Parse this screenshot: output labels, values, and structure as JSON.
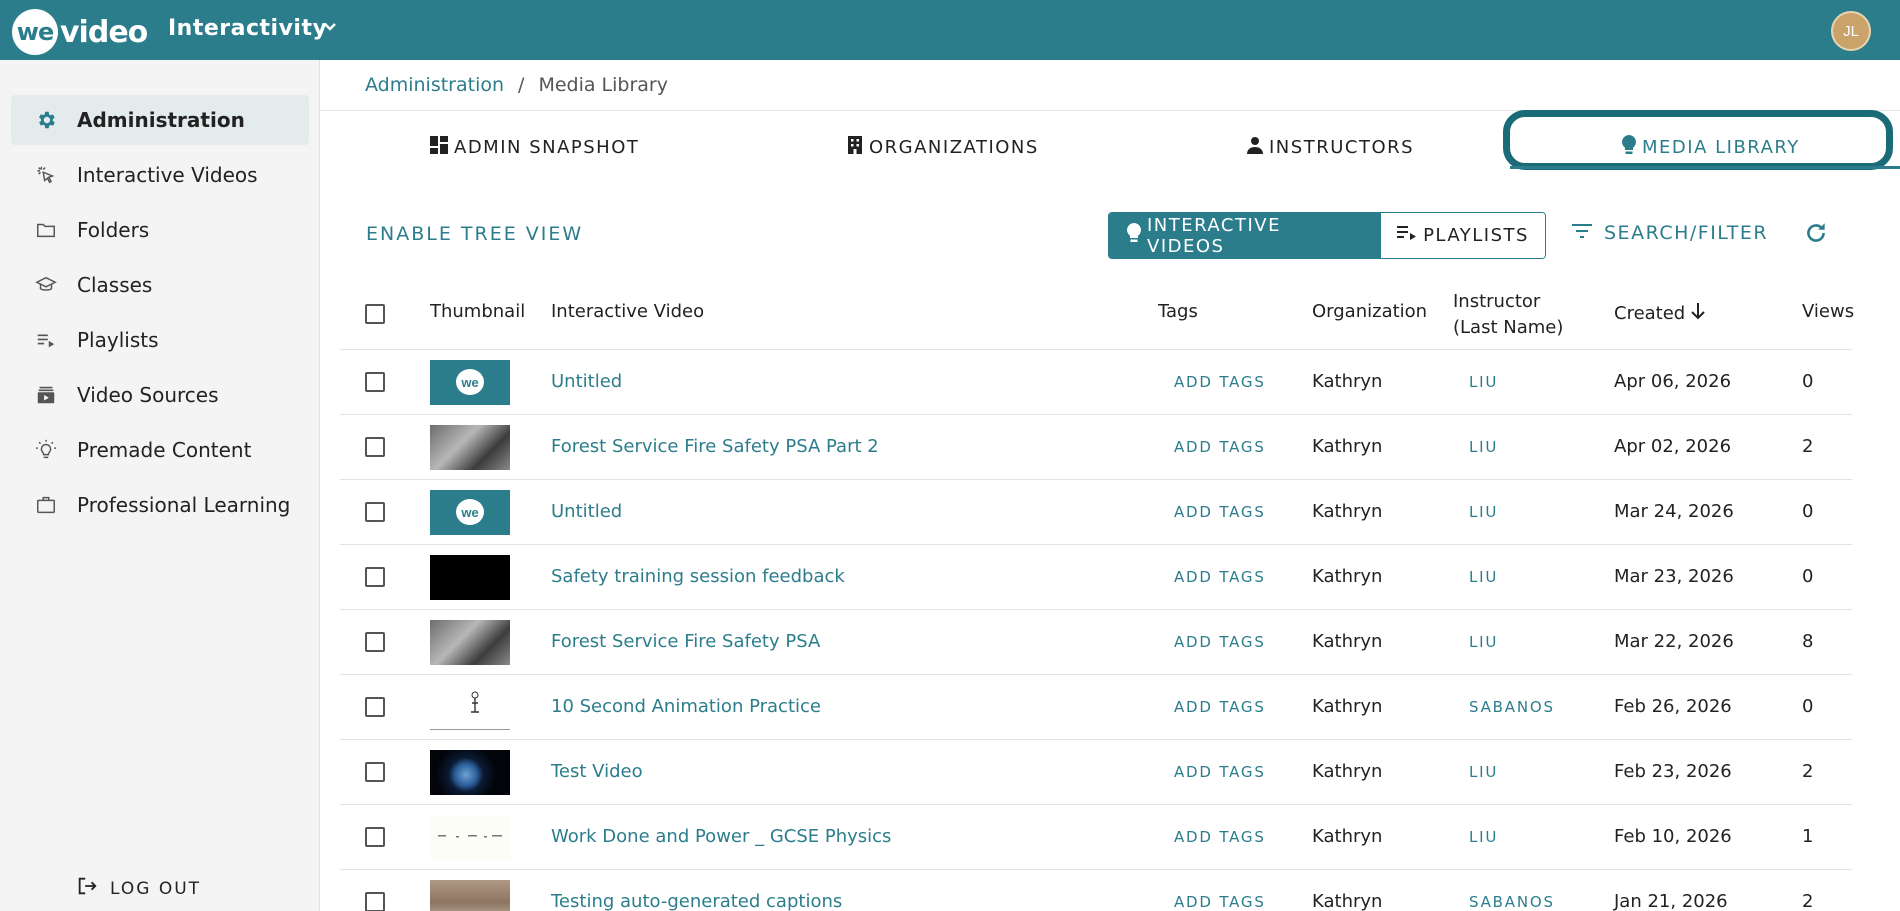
{
  "app": {
    "logo_text": "wevideo",
    "product_title": "Interactivity",
    "user_initials": "JL"
  },
  "breadcrumb": {
    "root": "Administration",
    "separator": "/",
    "current": "Media Library"
  },
  "sidebar": {
    "items": [
      {
        "label": "Administration",
        "icon": "gear-icon",
        "active": true
      },
      {
        "label": "Interactive Videos",
        "icon": "pointer-click-icon"
      },
      {
        "label": "Folders",
        "icon": "folder-icon"
      },
      {
        "label": "Classes",
        "icon": "graduation-cap-icon"
      },
      {
        "label": "Playlists",
        "icon": "playlist-icon"
      },
      {
        "label": "Video Sources",
        "icon": "video-library-icon"
      },
      {
        "label": "Premade Content",
        "icon": "lightbulb-icon"
      },
      {
        "label": "Professional Learning",
        "icon": "briefcase-icon"
      }
    ],
    "logout_label": "LOG OUT"
  },
  "tabs": [
    {
      "label": "ADMIN SNAPSHOT",
      "icon": "dashboard-icon"
    },
    {
      "label": "ORGANIZATIONS",
      "icon": "building-icon"
    },
    {
      "label": "INSTRUCTORS",
      "icon": "person-icon"
    },
    {
      "label": "MEDIA LIBRARY",
      "icon": "lightbulb-icon",
      "active": true
    }
  ],
  "toolbar": {
    "enable_tree_view": "ENABLE TREE VIEW",
    "interactive_videos": "INTERACTIVE VIDEOS",
    "playlists": "PLAYLISTS",
    "search_filter": "SEARCH/FILTER"
  },
  "table": {
    "headers": {
      "thumbnail": "Thumbnail",
      "title": "Interactive Video",
      "tags": "Tags",
      "organization": "Organization",
      "instructor_line1": "Instructor",
      "instructor_line2": "(Last Name)",
      "created": "Created",
      "views": "Views"
    },
    "sort": {
      "column": "Created",
      "direction": "descending"
    },
    "rows": [
      {
        "thumb": "we-logo",
        "title": "Untitled",
        "tags": "ADD TAGS",
        "org": "Kathryn",
        "instructor": "LIU",
        "created": "Apr 06, 2026",
        "views": "0"
      },
      {
        "thumb": "forest",
        "title": "Forest Service Fire Safety PSA Part 2",
        "tags": "ADD TAGS",
        "org": "Kathryn",
        "instructor": "LIU",
        "created": "Apr 02, 2026",
        "views": "2"
      },
      {
        "thumb": "we-logo",
        "title": "Untitled",
        "tags": "ADD TAGS",
        "org": "Kathryn",
        "instructor": "LIU",
        "created": "Mar 24, 2026",
        "views": "0"
      },
      {
        "thumb": "black",
        "title": "Safety training session feedback",
        "tags": "ADD TAGS",
        "org": "Kathryn",
        "instructor": "LIU",
        "created": "Mar 23, 2026",
        "views": "0"
      },
      {
        "thumb": "forest",
        "title": "Forest Service Fire Safety PSA",
        "tags": "ADD TAGS",
        "org": "Kathryn",
        "instructor": "LIU",
        "created": "Mar 22, 2026",
        "views": "8"
      },
      {
        "thumb": "animation",
        "title": "10 Second Animation Practice",
        "tags": "ADD TAGS",
        "org": "Kathryn",
        "instructor": "SABANOS",
        "created": "Feb 26, 2026",
        "views": "0"
      },
      {
        "thumb": "earth",
        "title": "Test Video",
        "tags": "ADD TAGS",
        "org": "Kathryn",
        "instructor": "LIU",
        "created": "Feb 23, 2026",
        "views": "2"
      },
      {
        "thumb": "work",
        "title": "Work Done and Power _ GCSE Physics",
        "tags": "ADD TAGS",
        "org": "Kathryn",
        "instructor": "LIU",
        "created": "Feb 10, 2026",
        "views": "1"
      },
      {
        "thumb": "person",
        "title": "Testing auto-generated captions",
        "tags": "ADD TAGS",
        "org": "Kathryn",
        "instructor": "SABANOS",
        "created": "Jan 21, 2026",
        "views": "2"
      }
    ]
  },
  "colors": {
    "brand": "#2c7d8c",
    "focus_ring": "#1b6a78",
    "sidebar_bg": "#f4f4f4"
  }
}
